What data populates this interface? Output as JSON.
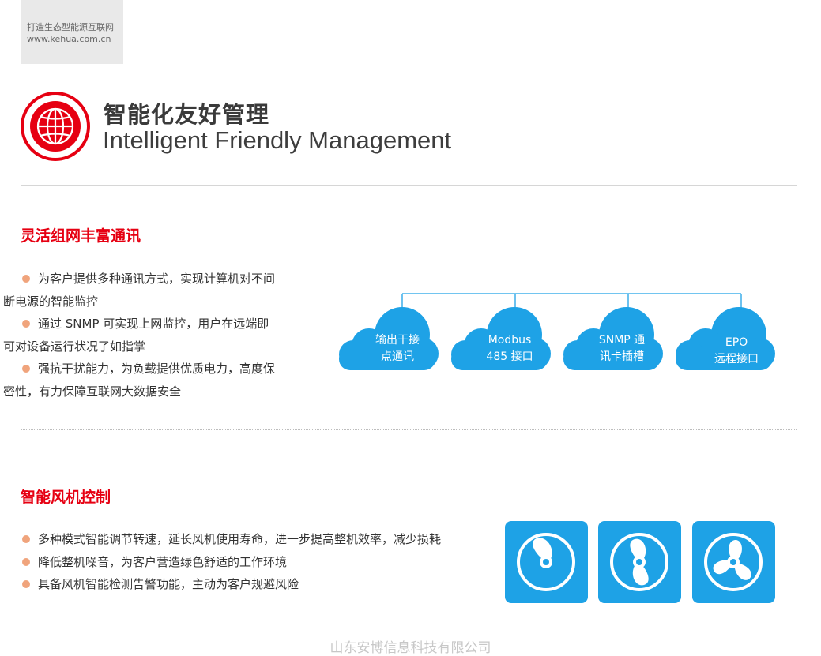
{
  "brand": {
    "slogan": "打造生态型能源互联网",
    "website": "www.kehua.com.cn",
    "accent_color": "#e60012"
  },
  "heading": {
    "icon": "globe-icon",
    "title_cn": "智能化友好管理",
    "title_en": "Intelligent Friendly Management"
  },
  "section_comm": {
    "title": "灵活组网丰富通讯",
    "bullets": [
      {
        "line1": "为客户提供多种通讯方式，实现计算机对不间",
        "line2": "断电源的智能监控"
      },
      {
        "line1": "通过 SNMP 可实现上网监控，用户在远端即",
        "line2": "可对设备运行状况了如指掌"
      },
      {
        "line1": "强抗干扰能力，为负载提供优质电力，高度保",
        "line2": "密性，有力保障互联网大数据安全"
      }
    ],
    "clouds": [
      {
        "line1": "输出干接",
        "line2": "点通讯",
        "icon": "cloud-icon"
      },
      {
        "line1": "Modbus",
        "line2": "485 接口",
        "icon": "cloud-icon"
      },
      {
        "line1": "SNMP 通",
        "line2": "讯卡插槽",
        "icon": "cloud-icon"
      },
      {
        "line1": "EPO",
        "line2": "远程接口",
        "icon": "cloud-icon"
      }
    ],
    "cloud_color": "#1ea2e6"
  },
  "section_fan": {
    "title": "智能风机控制",
    "bullets": [
      "多种模式智能调节转速，延长风机使用寿命，进一步提高整机效率，减少损耗",
      "降低整机噪音，为客户营造绿色舒适的工作环境",
      "具备风机智能检测告警功能，主动为客户规避风险"
    ],
    "tiles": [
      {
        "icon": "fan-one-blade-icon"
      },
      {
        "icon": "fan-two-blade-icon"
      },
      {
        "icon": "fan-three-blade-icon"
      }
    ],
    "tile_color": "#1ea2e6"
  },
  "footer": {
    "watermark": "山东安博信息科技有限公司"
  }
}
